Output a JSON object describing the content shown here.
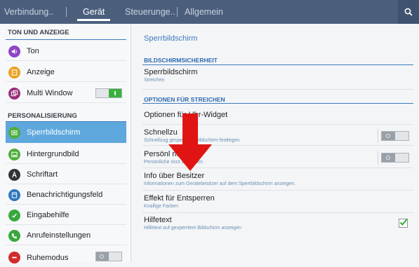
{
  "tabs": [
    {
      "label": "Verbindung.."
    },
    {
      "label": "Gerät"
    },
    {
      "label": "Steuerunge.."
    },
    {
      "label": "Allgemein"
    }
  ],
  "active_tab": "Gerät",
  "icons": {
    "search": "search-icon",
    "sound": "speaker-icon",
    "display": "display-icon",
    "multiwindow": "multiwindow-icon",
    "lockscreen": "lock-screen-icon",
    "wallpaper": "image-icon",
    "font": "font-icon",
    "notification": "notification-panel-icon",
    "input": "input-assist-icon",
    "calls": "phone-icon",
    "blocking": "block-icon"
  },
  "colors": {
    "topbar": "#4b5f7d",
    "accent": "#3c7bbf",
    "selected": "#5fa8dd",
    "toggle_on": "#38b23c",
    "checkbox": "#3aa83e",
    "arrow": "#e11414"
  },
  "sidebar": {
    "section1": "TON UND ANZEIGE",
    "section2": "PERSONALISIERUNG",
    "items": [
      {
        "label": "Ton"
      },
      {
        "label": "Anzeige"
      },
      {
        "label": "Multi Window",
        "toggle": "on"
      },
      {
        "label": "Sperrbildschirm",
        "selected": true
      },
      {
        "label": "Hintergrundbild"
      },
      {
        "label": "Schriftart"
      },
      {
        "label": "Benachrichtigungsfeld"
      },
      {
        "label": "Eingabehilfe"
      },
      {
        "label": "Anrufeinstellungen"
      },
      {
        "label": "Ruhemodus",
        "toggle": "off"
      }
    ]
  },
  "main": {
    "title": "Sperrbildschirm",
    "section1": "BILDSCHIRMSICHERHEIT",
    "section2": "OPTIONEN FÜR STREICHEN",
    "rows": [
      {
        "title": "Sperrbildschirm",
        "sub": "Streichen"
      },
      {
        "title": "Optionen für Uhr-Widget",
        "sub": ""
      },
      {
        "title": "Schnellzu",
        "sub": "Schnellzug           gesperrtem Bildschirm festlegen",
        "toggle": "off"
      },
      {
        "title": "Persönl            richt",
        "sub": "Persönliche              ricnt anpassen",
        "toggle": "off"
      },
      {
        "title": "Info über Besitzer",
        "sub": "Informationen zum Gerätebesitzer auf dem Sperrbildschirm anzeigen."
      },
      {
        "title": "Effekt für Entsperren",
        "sub": "Knallige Farben"
      },
      {
        "title": "Hilfetext",
        "sub": "Hilfetext auf gesperrtem Bildschirm anzeigen",
        "checked": true
      }
    ]
  }
}
